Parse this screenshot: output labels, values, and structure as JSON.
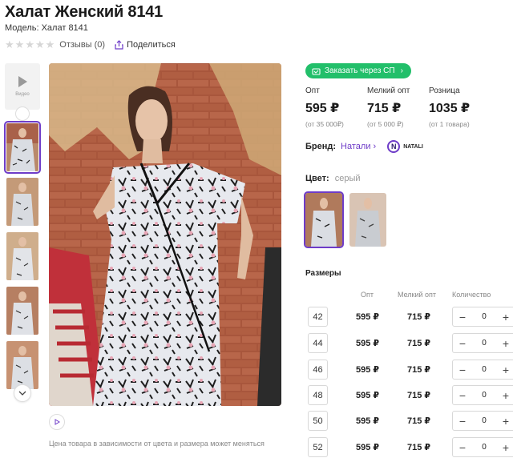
{
  "product": {
    "title": "Халат Женский 8141",
    "model": "Модель: Халат 8141",
    "reviews": "Отзывы (0)",
    "share": "Поделиться",
    "video_label": "Видео",
    "price_note": "Цена товара в зависимости от цвета и размера может меняться"
  },
  "order_button": "Заказать через СП",
  "prices": [
    {
      "label": "Опт",
      "value": "595 ₽",
      "note": "(от 35 000₽)"
    },
    {
      "label": "Мелкий опт",
      "value": "715 ₽",
      "note": "(от 5 000 ₽)"
    },
    {
      "label": "Розница",
      "value": "1035 ₽",
      "note": "(от 1 товара)"
    }
  ],
  "brand": {
    "label": "Бренд:",
    "name": "Натали",
    "logo_letter": "N",
    "logo_text": "NATALI"
  },
  "color": {
    "label": "Цвет:",
    "value": "серый"
  },
  "sizes": {
    "title": "Размеры",
    "headers": {
      "opt": "Опт",
      "small": "Мелкий опт",
      "qty": "Количество"
    },
    "rows": [
      {
        "size": "42",
        "opt": "595 ₽",
        "small": "715 ₽",
        "qty": "0"
      },
      {
        "size": "44",
        "opt": "595 ₽",
        "small": "715 ₽",
        "qty": "0"
      },
      {
        "size": "46",
        "opt": "595 ₽",
        "small": "715 ₽",
        "qty": "0"
      },
      {
        "size": "48",
        "opt": "595 ₽",
        "small": "715 ₽",
        "qty": "0"
      },
      {
        "size": "50",
        "opt": "595 ₽",
        "small": "715 ₽",
        "qty": "0"
      },
      {
        "size": "52",
        "opt": "595 ₽",
        "small": "715 ₽",
        "qty": "0"
      }
    ]
  },
  "colors": {
    "accent": "#6e3cc8",
    "green": "#22bf6a"
  }
}
